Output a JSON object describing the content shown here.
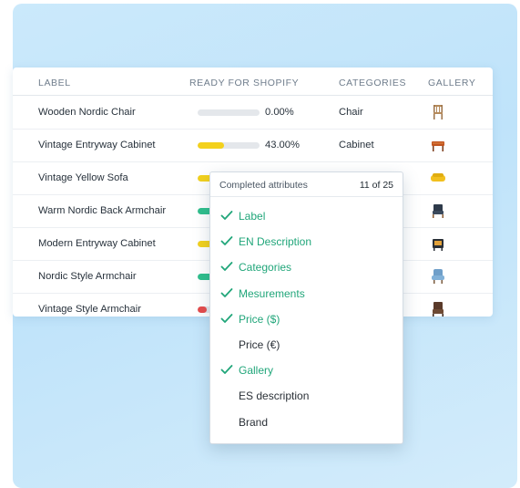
{
  "colors": {
    "done_green": "#21a67a",
    "bar_empty": "#e4e7eb",
    "bar_yellow": "#f3d11c",
    "bar_green": "#2fbf8c",
    "bar_red": "#e64b4b"
  },
  "table": {
    "headers": [
      "LABEL",
      "READY FOR SHOPIFY",
      "CATEGORIES",
      "GALLERY"
    ],
    "rows": [
      {
        "label": "Wooden Nordic Chair",
        "progress": 0.0,
        "progress_text": "0.00%",
        "category": "Chair",
        "bar_color": "bar_empty",
        "thumb": "wooden-chair-icon"
      },
      {
        "label": "Vintage Entryway Cabinet",
        "progress": 0.43,
        "progress_text": "43.00%",
        "category": "Cabinet",
        "bar_color": "bar_yellow",
        "thumb": "cabinet-icon"
      },
      {
        "label": "Vintage Yellow Sofa",
        "progress": 0.3,
        "progress_text": "",
        "category": "",
        "bar_color": "bar_yellow",
        "thumb": "yellow-sofa-icon"
      },
      {
        "label": "Warm Nordic Back Armchair",
        "progress": 0.6,
        "progress_text": "",
        "category": "",
        "bar_color": "bar_green",
        "thumb": "armchair-icon"
      },
      {
        "label": "Modern Entryway Cabinet",
        "progress": 0.3,
        "progress_text": "",
        "category": "",
        "bar_color": "bar_yellow",
        "thumb": "modern-cabinet-icon"
      },
      {
        "label": "Nordic Style Armchair",
        "progress": 0.6,
        "progress_text": "",
        "category": "",
        "bar_color": "bar_green",
        "thumb": "blue-armchair-icon"
      },
      {
        "label": "Vintage Style Armchair",
        "progress": 0.15,
        "progress_text": "",
        "category": "",
        "bar_color": "bar_red",
        "thumb": "vintage-armchair-icon"
      }
    ]
  },
  "popup": {
    "title": "Completed attributes",
    "count": "11 of 25",
    "attributes": [
      {
        "label": "Label",
        "done": true
      },
      {
        "label": "EN Description",
        "done": true
      },
      {
        "label": "Categories",
        "done": true
      },
      {
        "label": "Mesurements",
        "done": true
      },
      {
        "label": "Price ($)",
        "done": true
      },
      {
        "label": "Price (€)",
        "done": false
      },
      {
        "label": "Gallery",
        "done": true
      },
      {
        "label": "ES description",
        "done": false
      },
      {
        "label": "Brand",
        "done": false
      }
    ]
  }
}
